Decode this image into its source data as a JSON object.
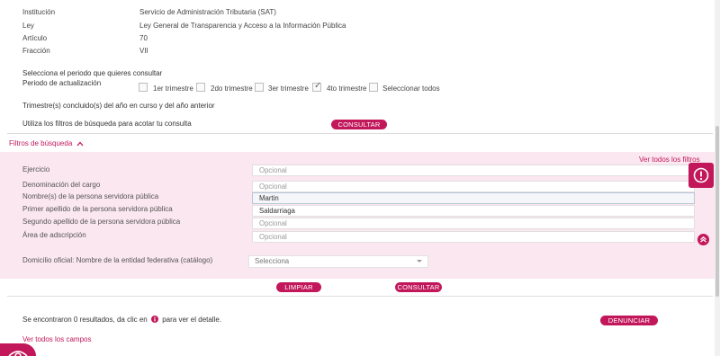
{
  "info": [
    {
      "label": "Institución",
      "value": "Servicio de Administración Tributaria (SAT)"
    },
    {
      "label": "Ley",
      "value": "Ley General de Transparencia y Acceso a la Información Pública"
    },
    {
      "label": "Artículo",
      "value": "70"
    },
    {
      "label": "Fracción",
      "value": "VII"
    }
  ],
  "period": {
    "prompt": "Selecciona el periodo que quieres consultar",
    "label": "Periodo de actualización",
    "options": [
      {
        "label": "1er trimestre",
        "checked": false
      },
      {
        "label": "2do trimestre",
        "checked": false
      },
      {
        "label": "3er trimestre",
        "checked": false
      },
      {
        "label": "4to trimestre",
        "checked": true
      },
      {
        "label": "Seleccionar todos",
        "checked": false
      }
    ],
    "note": "Trimestre(s) concluido(s) del año en curso y del año anterior"
  },
  "consult": {
    "text": "Utiliza los filtros de búsqueda para acotar tu consulta",
    "button": "CONSULTAR"
  },
  "filters": {
    "toggle_label": "Filtros de búsqueda",
    "see_all": "Ver todos los filtros",
    "fields": [
      {
        "label": "Ejercicio",
        "placeholder": "Opcional",
        "value": ""
      },
      {
        "label": "Denominación del cargo",
        "placeholder": "Opcional",
        "value": ""
      },
      {
        "label": "Nombre(s) de la persona servidora pública",
        "placeholder": "Opcional",
        "value": "Martin"
      },
      {
        "label": "Primer apellido de la persona servidora pública",
        "placeholder": "Opcional",
        "value": "Saldarriaga"
      },
      {
        "label": "Segundo apellido de la persona servidora pública",
        "placeholder": "Opcional",
        "value": ""
      },
      {
        "label": "Área de adscripción",
        "placeholder": "Opcional",
        "value": ""
      }
    ],
    "domicilio_label": "Domicilio oficial: Nombre de la entidad federativa (catálogo)",
    "domicilio_value": "Selecciona",
    "clear_button": "LIMPIAR",
    "consult_button": "CONSULTAR"
  },
  "results": {
    "text_before": "Se encontraron 0 resultados, da clic en",
    "text_after": "para ver el detalle.",
    "report_button": "DENUNCIAR",
    "see_all_fields": "Ver todos los campos"
  },
  "colors": {
    "accent": "#c2185b",
    "panel": "#fbe7ef"
  }
}
